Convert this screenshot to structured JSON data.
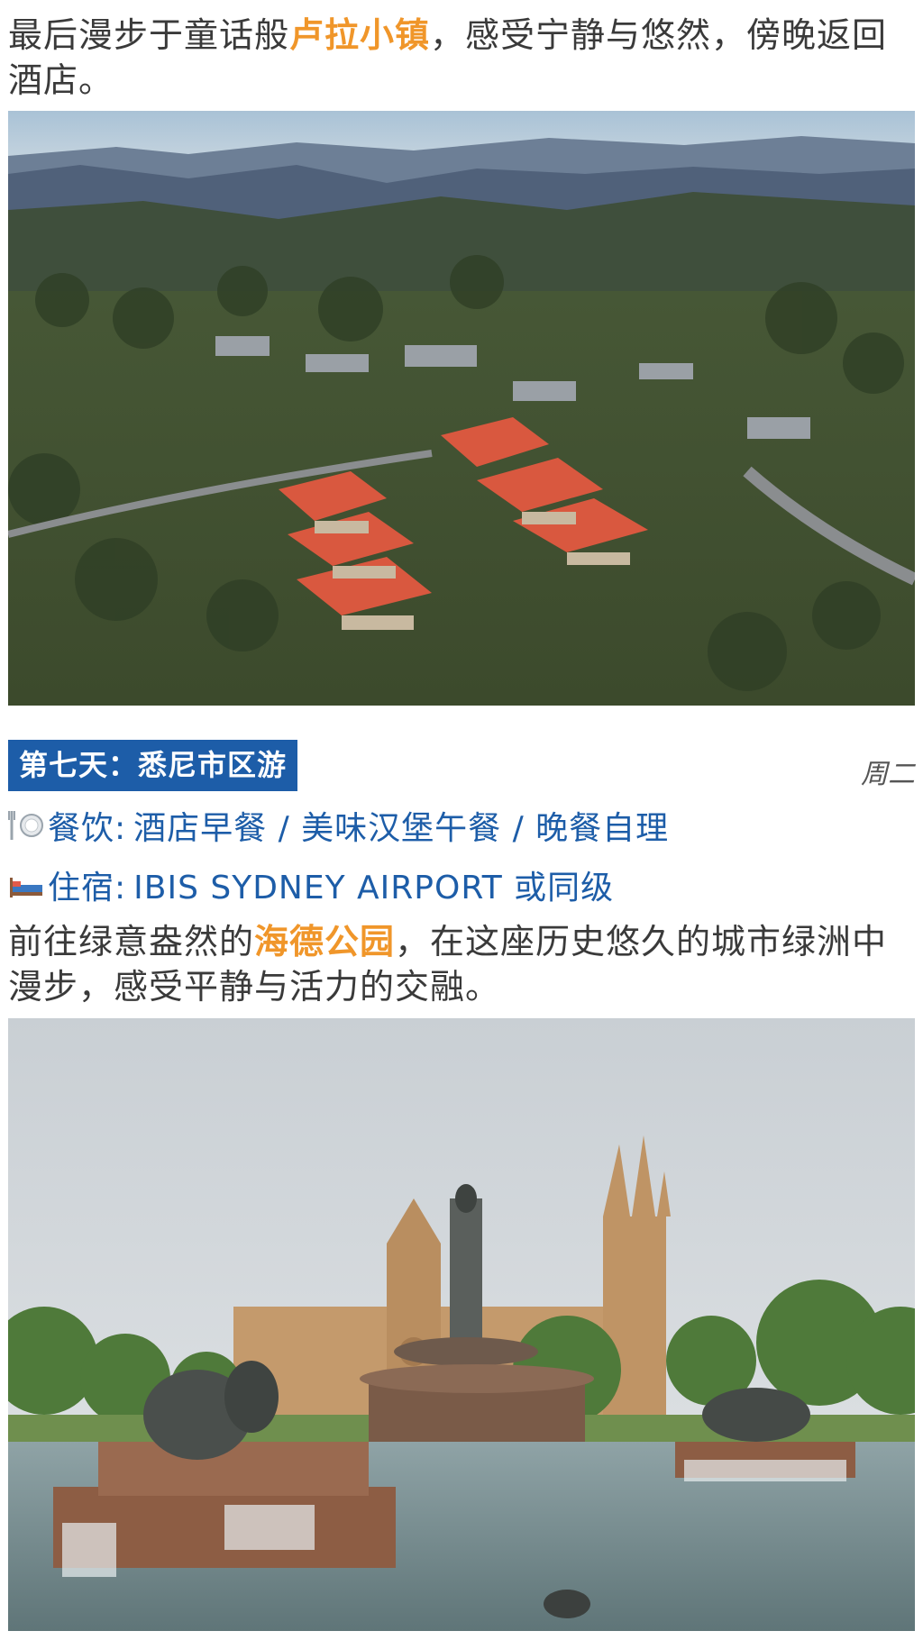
{
  "intro": {
    "before": "最后漫步于童话般",
    "highlight": "卢拉小镇",
    "after": "，感受宁静与悠然，傍晚返回酒店。"
  },
  "images": [
    {
      "name": "leura-aerial-photo"
    },
    {
      "name": "hyde-park-fountain-photo"
    }
  ],
  "day": {
    "title": "第七天：悉尼市区游",
    "weekday": "周二",
    "meals": {
      "label": "餐饮:",
      "value": "酒店早餐 / 美味汉堡午餐 / 晚餐自理"
    },
    "lodging": {
      "label": "住宿:",
      "value": "IBIS SYDNEY AIRPORT 或同级"
    },
    "description": {
      "before": "前往绿意盎然的",
      "highlight": "海德公园",
      "after": "，在这座历史悠久的城市绿洲中漫步，感受平静与活力的交融。"
    }
  },
  "colors": {
    "accent_blue": "#1d5da8",
    "highlight_orange": "#f0962a",
    "body_text": "#3a3a3a"
  },
  "icons": {
    "meals": "fork-plate-icon",
    "lodging": "bed-icon"
  }
}
